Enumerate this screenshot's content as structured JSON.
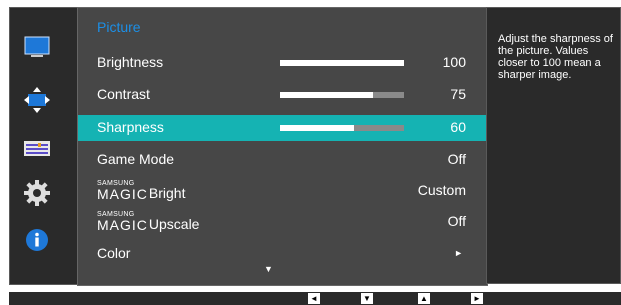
{
  "menu": {
    "title": "Picture",
    "title_color": "#1c8fe6",
    "accent": "#15b3b3",
    "rows": [
      {
        "label": "Brightness",
        "value": "100",
        "level": 1.0
      },
      {
        "label": "Contrast",
        "value": "75",
        "level": 0.75
      },
      {
        "label": "Sharpness",
        "value": "60",
        "level": 0.6,
        "selected": true
      },
      {
        "label": "Game Mode",
        "value": "Off"
      },
      {
        "brand_top": "SAMSUNG",
        "brand_main": "MAGIC",
        "label": "Bright",
        "value": "Custom"
      },
      {
        "brand_top": "SAMSUNG",
        "brand_main": "MAGIC",
        "label": "Upscale",
        "value": "Off"
      },
      {
        "label": "Color",
        "value": "►"
      }
    ],
    "more_indicator": "▼"
  },
  "help": {
    "text": "Adjust the sharpness of the picture. Values closer to 100 mean a sharper image."
  },
  "sidebar": {
    "icons": [
      "picture-icon",
      "position-icon",
      "system-icon",
      "settings-gear-icon",
      "information-icon"
    ]
  },
  "nav": {
    "left": "◄",
    "down": "▼",
    "up": "▲",
    "right": "►"
  }
}
